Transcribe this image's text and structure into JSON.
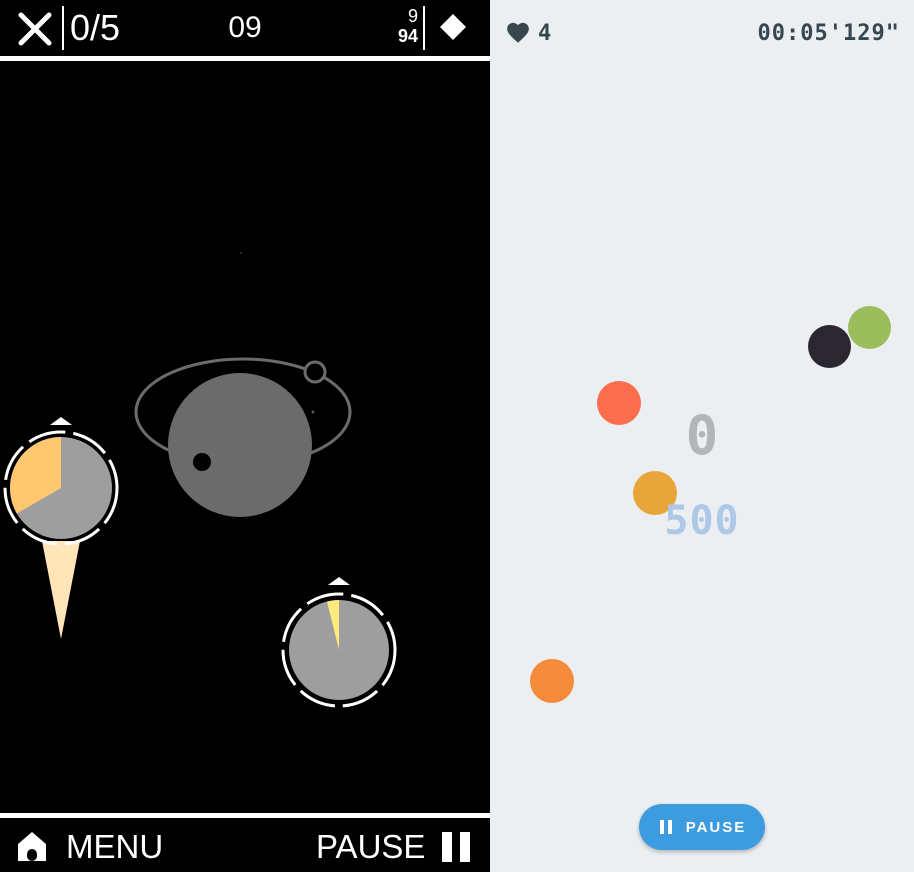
{
  "left_game": {
    "hud": {
      "progress_counter": "0/5",
      "level": "09",
      "fraction_top": "9",
      "fraction_bottom": "94",
      "close_icon": "close-icon",
      "diamond_icon": "diamond-icon"
    },
    "bottom_bar": {
      "menu_label": "MENU",
      "pause_label": "PAUSE",
      "home_icon": "home-icon",
      "pause_icon": "pause-icon"
    },
    "colors": {
      "planet": "#6b6b6b",
      "dial": "#9e9e9e",
      "dial_fill_orange": "#ffc870",
      "dial_fill_yellow": "#ffea80",
      "flame": "#ffe5b8",
      "orbit": "#6b6b6b"
    }
  },
  "right_game": {
    "lives": "4",
    "timer": "00:05'129\"",
    "score": "0",
    "points": "500",
    "pause_button_label": "PAUSE",
    "colors": {
      "background": "#eceff1",
      "hud_text": "#37474f",
      "ball_red": "#fb6d4c",
      "ball_amber": "#e8a63a",
      "ball_orange": "#f48b3b",
      "ball_dark": "#2b2630",
      "ball_green": "#9bbd5b",
      "button": "#3d9be0"
    }
  }
}
